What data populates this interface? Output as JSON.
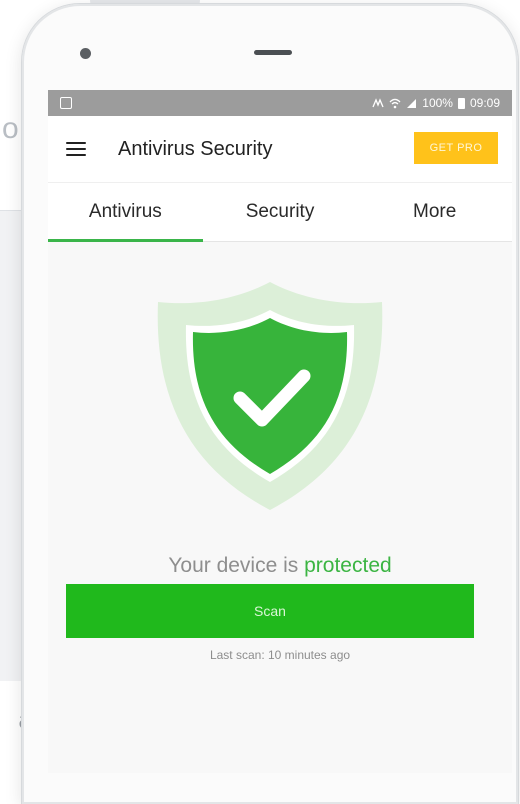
{
  "background": {
    "edge_text": "at",
    "edge_glyph": "o"
  },
  "statusbar": {
    "left_icon": "notification-icon",
    "right_text": "100%",
    "time": "09:09",
    "icons": [
      "nfc-icon",
      "wifi-icon",
      "signal-icon",
      "battery-icon"
    ]
  },
  "appbar": {
    "menu_icon": "menu-icon",
    "title": "Antivirus Security",
    "get_pro_label": "GET PRO"
  },
  "tabs": [
    {
      "label": "Antivirus",
      "active": true
    },
    {
      "label": "Security",
      "active": false
    },
    {
      "label": "More",
      "active": false
    }
  ],
  "main": {
    "shield_icon": "shield-check-icon",
    "status_prefix": "Your device is ",
    "status_highlight": "protected",
    "scan_label": "Scan",
    "last_scan": "Last scan: 10 minutes ago"
  },
  "colors": {
    "accent_green": "#20b91c",
    "shield_green": "#37b43b",
    "shield_halo": "#dcefd8",
    "get_pro_yellow": "#ffc21a",
    "statusbar_gray": "#9c9c9c"
  }
}
